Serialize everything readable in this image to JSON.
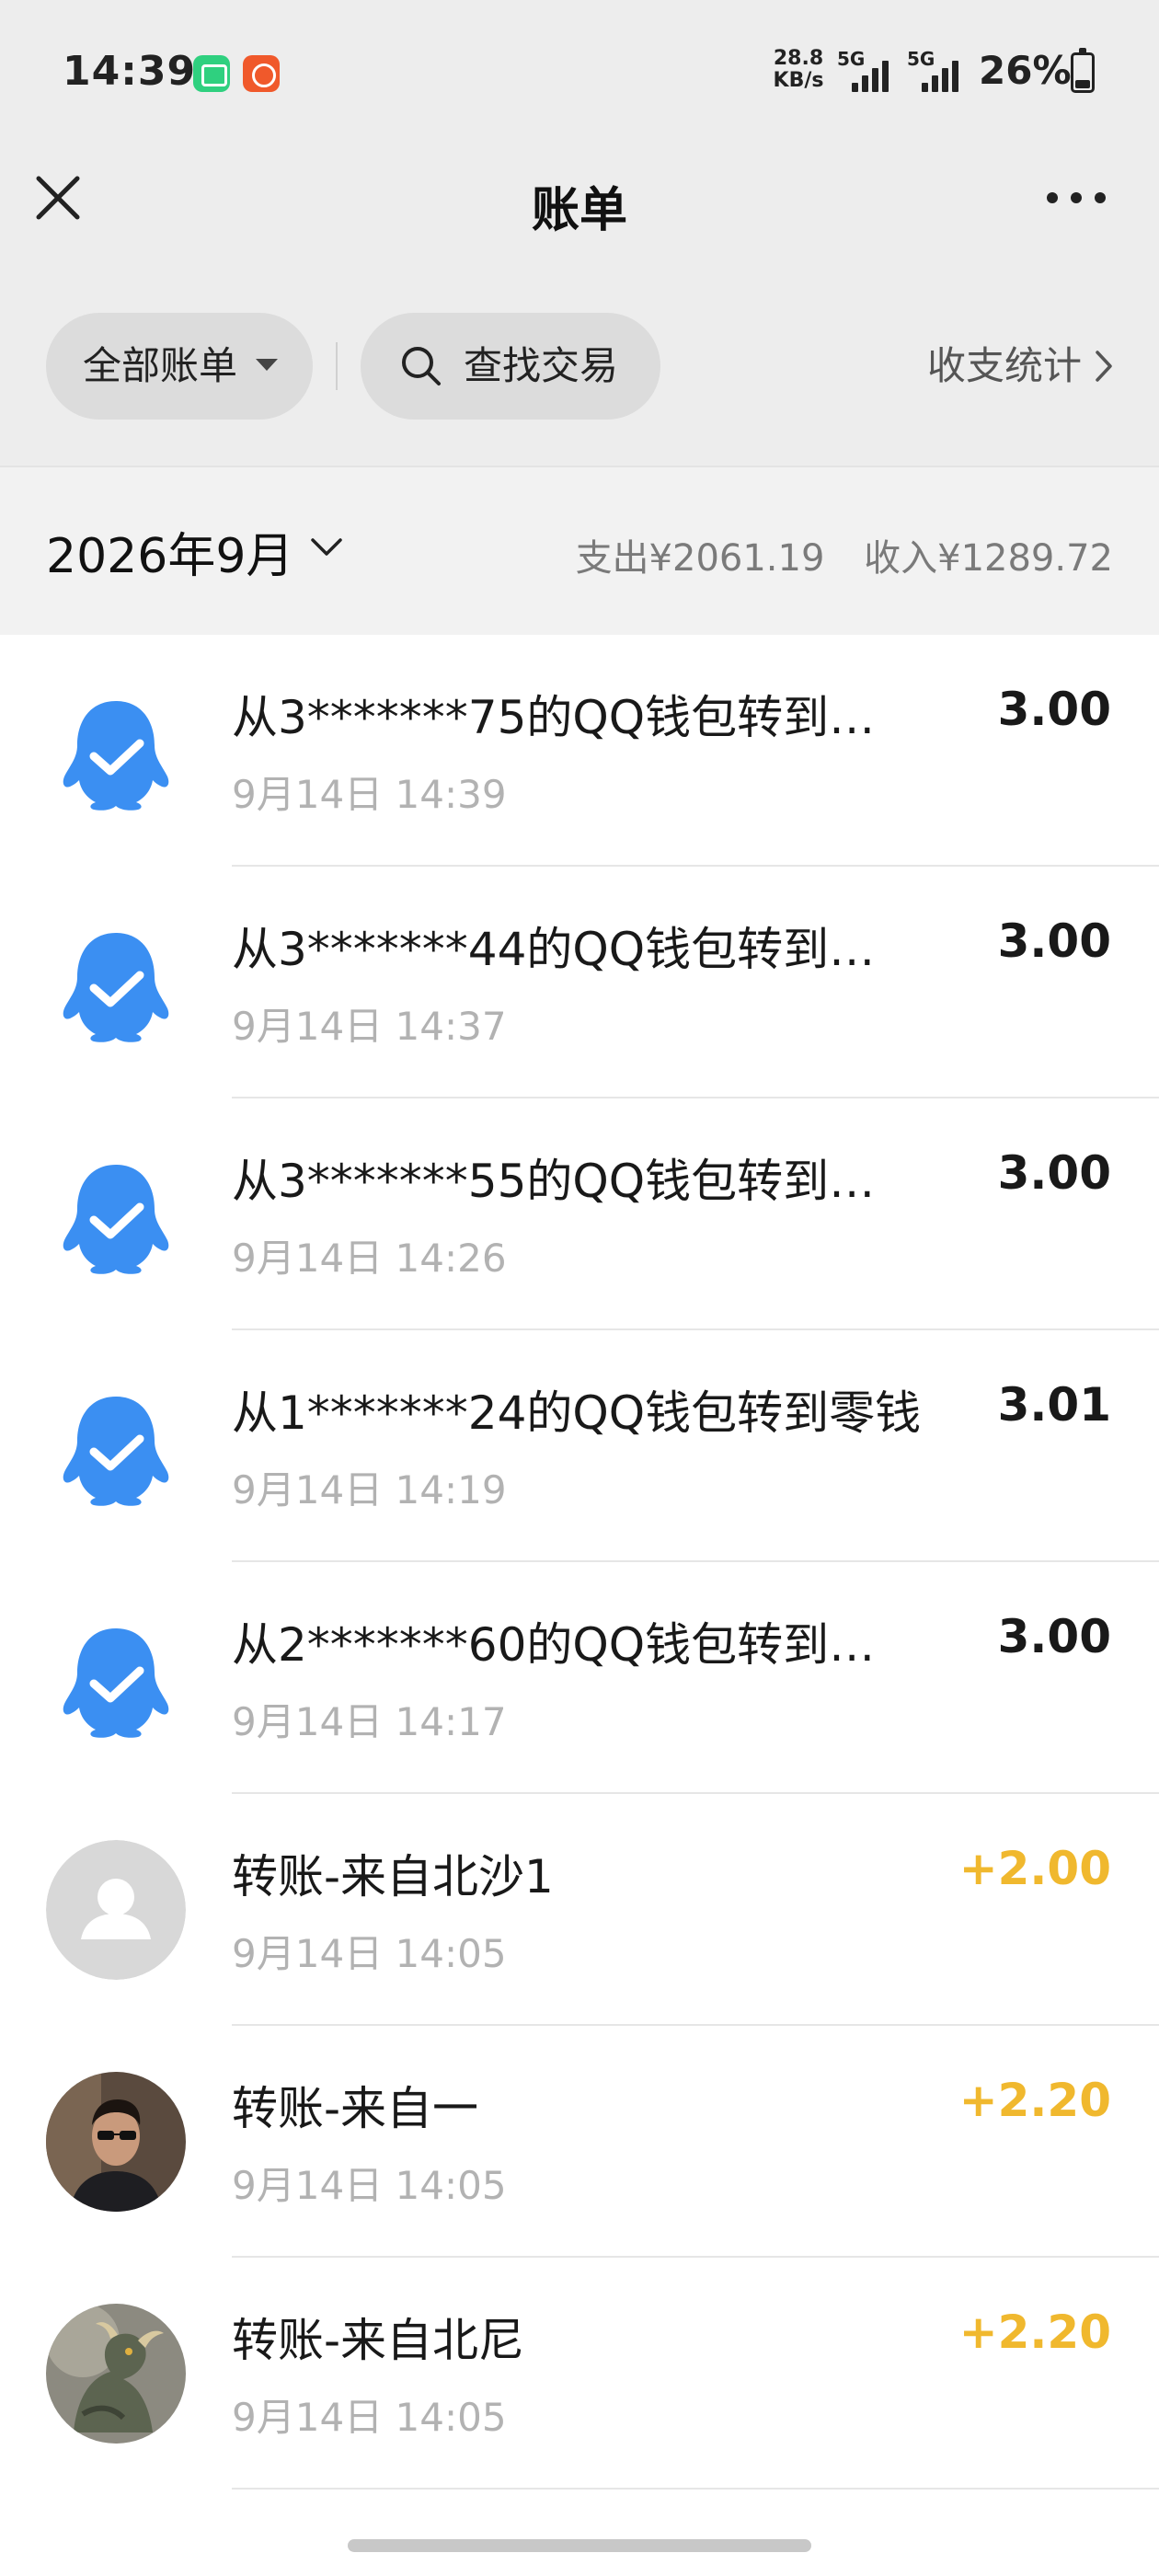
{
  "status_bar": {
    "time": "14:39",
    "net_speed_value": "28.8",
    "net_speed_unit": "KB/s",
    "signal_1_label": "5G",
    "signal_2_label": "5G",
    "battery_text": "26%",
    "battery_level": 0.26,
    "app_icons": [
      "green-app-icon",
      "orange-app-icon"
    ]
  },
  "nav": {
    "title": "账单",
    "close_icon": "close-icon",
    "more_icon": "more-icon"
  },
  "filters": {
    "all_bills": "全部账单",
    "search": "查找交易",
    "stats": "收支统计"
  },
  "summary": {
    "month": "2026年9月",
    "expense": "支出¥2061.19",
    "income": "收入¥1289.72"
  },
  "colors": {
    "qq_blue": "#3b8ff2",
    "income_yellow": "#f0b82e",
    "gray_background": "#ededed"
  },
  "transactions": [
    {
      "title": "从3*******75的QQ钱包转到…",
      "date": "9月14日 14:39",
      "amount": "3.00",
      "icon": "qq-penguin-icon",
      "income": false
    },
    {
      "title": "从3*******44的QQ钱包转到…",
      "date": "9月14日 14:37",
      "amount": "3.00",
      "icon": "qq-penguin-icon",
      "income": false
    },
    {
      "title": "从3*******55的QQ钱包转到…",
      "date": "9月14日 14:26",
      "amount": "3.00",
      "icon": "qq-penguin-icon",
      "income": false
    },
    {
      "title": "从1*******24的QQ钱包转到零钱",
      "date": "9月14日 14:19",
      "amount": "3.01",
      "icon": "qq-penguin-icon",
      "income": false
    },
    {
      "title": "从2*******60的QQ钱包转到…",
      "date": "9月14日 14:17",
      "amount": "3.00",
      "icon": "qq-penguin-icon",
      "income": false
    },
    {
      "title": "转账-来自北沙1",
      "date": "9月14日 14:05",
      "amount": "+2.00",
      "icon": "default-avatar",
      "income": true
    },
    {
      "title": "转账-来自一",
      "date": "9月14日 14:05",
      "amount": "+2.20",
      "icon": "man-photo-avatar",
      "income": true
    },
    {
      "title": "转账-来自北尼",
      "date": "9月14日 14:05",
      "amount": "+2.20",
      "icon": "dragon-photo-avatar",
      "income": true
    }
  ]
}
